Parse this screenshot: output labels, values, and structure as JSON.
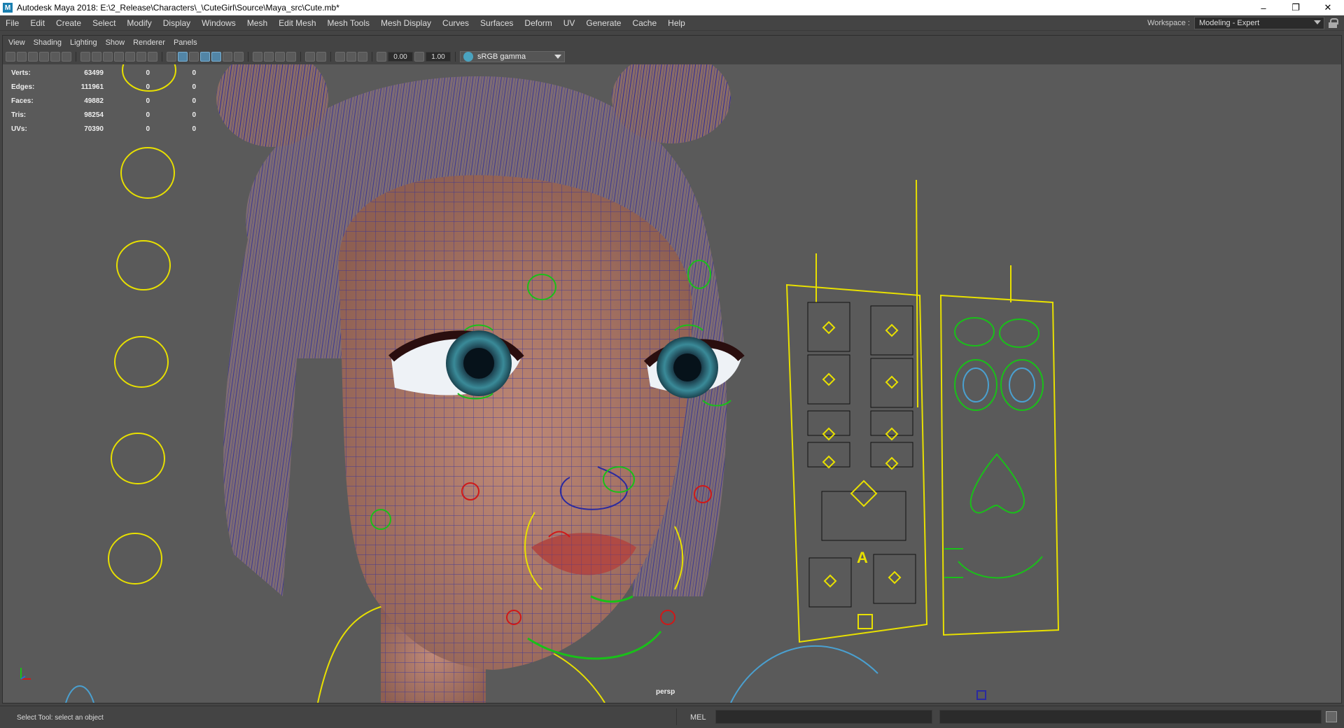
{
  "window": {
    "title": "Autodesk Maya 2018: E:\\2_Release\\Characters\\_\\CuteGirl\\Source\\Maya_src\\Cute.mb*",
    "app_icon": "M",
    "controls": {
      "minimize": "–",
      "restore": "❐",
      "close": "✕"
    }
  },
  "main_menu": [
    "File",
    "Edit",
    "Create",
    "Select",
    "Modify",
    "Display",
    "Windows",
    "Mesh",
    "Edit Mesh",
    "Mesh Tools",
    "Mesh Display",
    "Curves",
    "Surfaces",
    "Deform",
    "UV",
    "Generate",
    "Cache",
    "Help"
  ],
  "workspace": {
    "label": "Workspace :",
    "value": "Modeling - Expert"
  },
  "panel_menu": [
    "View",
    "Shading",
    "Lighting",
    "Show",
    "Renderer",
    "Panels"
  ],
  "panel_toolbar": {
    "exposure": "0.00",
    "gamma": "1.00",
    "color_space": "sRGB gamma"
  },
  "hud": {
    "rows": [
      {
        "label": "Verts:",
        "v1": "63499",
        "v2": "0",
        "v3": "0"
      },
      {
        "label": "Edges:",
        "v1": "111961",
        "v2": "0",
        "v3": "0"
      },
      {
        "label": "Faces:",
        "v1": "49882",
        "v2": "0",
        "v3": "0"
      },
      {
        "label": "Tris:",
        "v1": "98254",
        "v2": "0",
        "v3": "0"
      },
      {
        "label": "UVs:",
        "v1": "70390",
        "v2": "0",
        "v3": "0"
      }
    ]
  },
  "viewport": {
    "camera": "persp",
    "rig_panel_letter": "A"
  },
  "status": {
    "help_line": "Select Tool: select an object",
    "command_language": "MEL"
  },
  "colors": {
    "viewport_bg": "#5a5a5a",
    "wire": "#2a2aa0",
    "skin": "#b07868",
    "lips": "#b04a44",
    "control_yellow": "#e8e000",
    "control_green": "#19c019",
    "control_red": "#d01818",
    "control_cyan": "#4aa0d0"
  }
}
